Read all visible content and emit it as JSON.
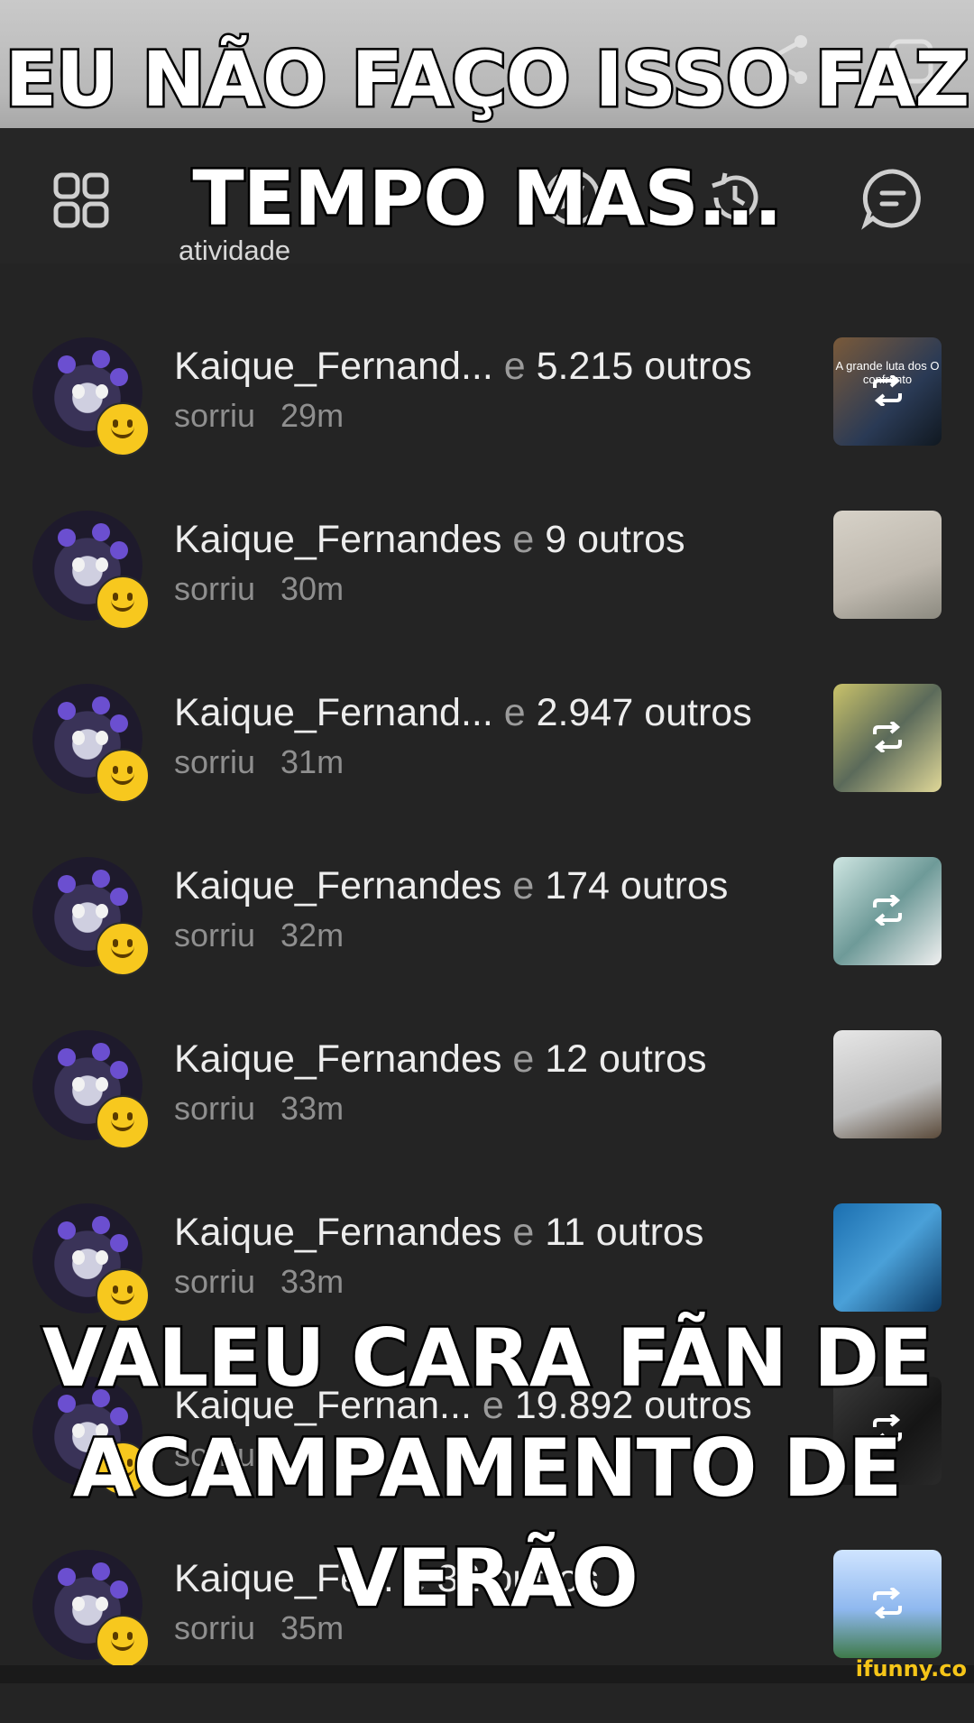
{
  "background_ghost": {
    "text": "e"
  },
  "header": {
    "tab_label": "atividade",
    "icons": [
      "grid-icon",
      "compass-icon",
      "history-icon",
      "chat-icon"
    ]
  },
  "activity": [
    {
      "name": "Kaique_Fernand...",
      "connector": "e",
      "others": "5.215 outros",
      "action": "sorriu",
      "time": "29m",
      "thumb": "t1",
      "thumb_text": "A grande luta dos\nO confronto",
      "repost": true
    },
    {
      "name": "Kaique_Fernandes",
      "connector": "e",
      "others": "9 outros",
      "action": "sorriu",
      "time": "30m",
      "thumb": "t2",
      "thumb_text": "",
      "repost": false
    },
    {
      "name": "Kaique_Fernand...",
      "connector": "e",
      "others": "2.947 outros",
      "action": "sorriu",
      "time": "31m",
      "thumb": "t3",
      "thumb_text": "",
      "repost": true
    },
    {
      "name": "Kaique_Fernandes",
      "connector": "e",
      "others": "174 outros",
      "action": "sorriu",
      "time": "32m",
      "thumb": "t4",
      "thumb_text": "",
      "repost": true
    },
    {
      "name": "Kaique_Fernandes",
      "connector": "e",
      "others": "12 outros",
      "action": "sorriu",
      "time": "33m",
      "thumb": "t5",
      "thumb_text": "",
      "repost": false
    },
    {
      "name": "Kaique_Fernandes",
      "connector": "e",
      "others": "11 outros",
      "action": "sorriu",
      "time": "33m",
      "thumb": "t6",
      "thumb_text": "",
      "repost": false
    },
    {
      "name": "Kaique_Fernan...",
      "connector": "e",
      "others": "19.892 outros",
      "action": "sorriu",
      "time": "",
      "thumb": "t7",
      "thumb_text": "",
      "repost": true
    },
    {
      "name": "Kaique_Fe...",
      "connector": "e",
      "others": "32 outros",
      "action": "sorriu",
      "time": "35m",
      "thumb": "t8",
      "thumb_text": "",
      "repost": true
    }
  ],
  "meme": {
    "top_line1": "EU NÃO FAÇO ISSO FAZ",
    "top_line2": "TEMPO MAS...",
    "bottom_line1": "VALEU CARA FÃN DE",
    "bottom_line2": "ACAMPAMENTO DE",
    "bottom_line3": "VERÃO"
  },
  "watermark": "ifunny.co",
  "colors": {
    "background": "#242424",
    "smiley": "#f7c81e",
    "muted_text": "#8f8f8f",
    "watermark": "#f5c518"
  }
}
